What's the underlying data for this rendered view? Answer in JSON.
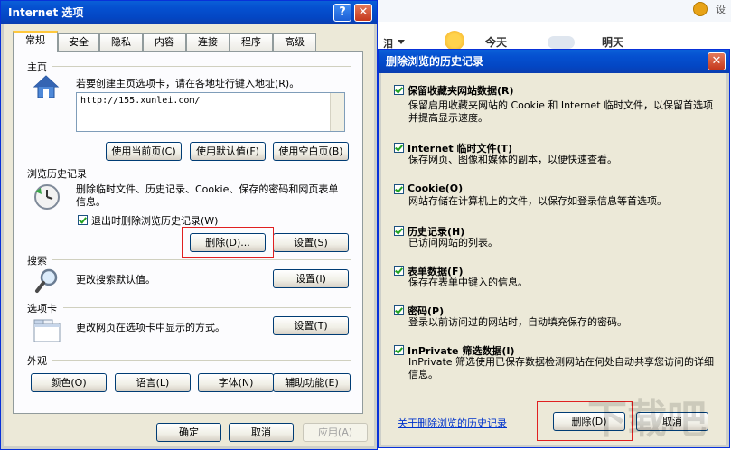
{
  "background": {
    "tab_label": "泪",
    "today": "今天",
    "tomorrow": "明天",
    "corner": "设"
  },
  "internet_options": {
    "title": "Internet 选项",
    "help_label": "?",
    "close_label": "✕",
    "tabs": [
      "常规",
      "安全",
      "隐私",
      "内容",
      "连接",
      "程序",
      "高级"
    ],
    "home": {
      "section": "主页",
      "hint": "若要创建主页选项卡，请在各地址行键入地址(R)。",
      "url": "http://155.xunlei.com/",
      "btn_current": "使用当前页(C)",
      "btn_default": "使用默认值(F)",
      "btn_blank": "使用空白页(B)"
    },
    "history": {
      "section": "浏览历史记录",
      "desc": "删除临时文件、历史记录、Cookie、保存的密码和网页表单信息。",
      "checkbox": "退出时删除浏览历史记录(W)",
      "btn_delete": "删除(D)...",
      "btn_settings": "设置(S)"
    },
    "search": {
      "section": "搜索",
      "desc": "更改搜索默认值。",
      "btn_settings": "设置(I)"
    },
    "tabs_section": {
      "section": "选项卡",
      "desc": "更改网页在选项卡中显示的方式。",
      "btn_settings": "设置(T)"
    },
    "appearance": {
      "section": "外观",
      "btn_colors": "颜色(O)",
      "btn_languages": "语言(L)",
      "btn_fonts": "字体(N)",
      "btn_accessibility": "辅助功能(E)"
    },
    "footer": {
      "ok": "确定",
      "cancel": "取消",
      "apply": "应用(A)"
    }
  },
  "delete_history": {
    "title": "删除浏览的历史记录",
    "close_label": "✕",
    "items": [
      {
        "title": "保留收藏夹网站数据(R)",
        "desc": "保留启用收藏夹网站的 Cookie 和 Internet 临时文件，以保留首选项并提高显示速度。"
      },
      {
        "title": "Internet 临时文件(T)",
        "desc": "保存网页、图像和媒体的副本，以便快速查看。"
      },
      {
        "title": "Cookie(O)",
        "desc": "网站存储在计算机上的文件，以保存如登录信息等首选项。"
      },
      {
        "title": "历史记录(H)",
        "desc": "已访问网站的列表。"
      },
      {
        "title": "表单数据(F)",
        "desc": "保存在表单中键入的信息。"
      },
      {
        "title": "密码(P)",
        "desc": "登录以前访问过的网站时，自动填充保存的密码。"
      },
      {
        "title": "InPrivate 筛选数据(I)",
        "desc": "InPrivate 筛选使用已保存数据检测网站在何处自动共享您访问的详细信息。"
      }
    ],
    "about_link": "关于删除浏览的历史记录",
    "btn_delete": "删除(D)",
    "btn_cancel": "取消"
  },
  "watermark": "下载吧"
}
